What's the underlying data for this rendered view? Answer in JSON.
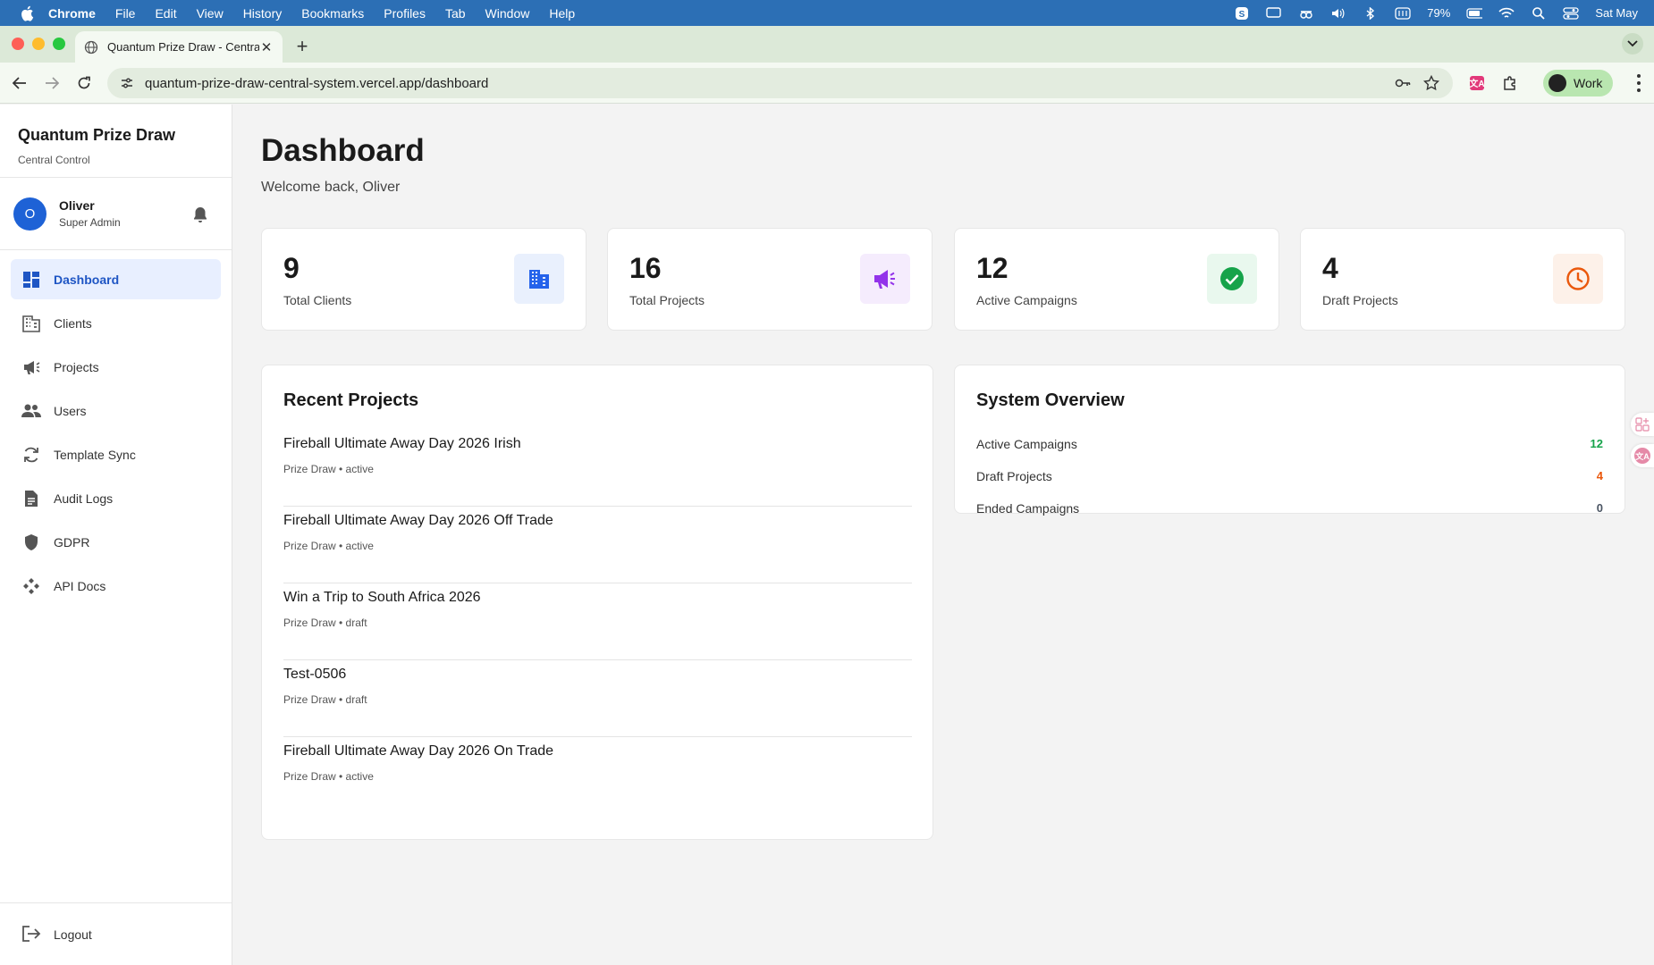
{
  "menubar": {
    "app": "Chrome",
    "items": [
      "File",
      "Edit",
      "View",
      "History",
      "Bookmarks",
      "Profiles",
      "Tab",
      "Window",
      "Help"
    ],
    "battery": "79%",
    "clock": "Sat May"
  },
  "browser": {
    "tab_title": "Quantum Prize Draw - Central",
    "url": "quantum-prize-draw-central-system.vercel.app/dashboard",
    "profile_label": "Work"
  },
  "sidebar": {
    "brand_name": "Quantum Prize Draw",
    "brand_sub": "Central Control",
    "user": {
      "initial": "O",
      "name": "Oliver",
      "role": "Super Admin"
    },
    "items": [
      {
        "label": "Dashboard",
        "icon": "dashboard-icon",
        "active": true
      },
      {
        "label": "Clients",
        "icon": "building-icon"
      },
      {
        "label": "Projects",
        "icon": "megaphone-icon"
      },
      {
        "label": "Users",
        "icon": "users-icon"
      },
      {
        "label": "Template Sync",
        "icon": "sync-icon"
      },
      {
        "label": "Audit Logs",
        "icon": "document-icon"
      },
      {
        "label": "GDPR",
        "icon": "shield-icon"
      },
      {
        "label": "API Docs",
        "icon": "api-icon"
      }
    ],
    "logout_label": "Logout"
  },
  "page": {
    "title": "Dashboard",
    "welcome": "Welcome back, Oliver"
  },
  "stats": [
    {
      "value": "9",
      "label": "Total Clients",
      "icon": "building-icon",
      "color": "#2563eb",
      "bg": "#e9f0fd"
    },
    {
      "value": "16",
      "label": "Total Projects",
      "icon": "megaphone-icon",
      "color": "#9333ea",
      "bg": "#f5ecfd"
    },
    {
      "value": "12",
      "label": "Active Campaigns",
      "icon": "check-circle-icon",
      "color": "#16a34a",
      "bg": "#e9f8ee"
    },
    {
      "value": "4",
      "label": "Draft Projects",
      "icon": "clock-icon",
      "color": "#ea580c",
      "bg": "#fdf1e9"
    }
  ],
  "recent_projects": {
    "title": "Recent Projects",
    "items": [
      {
        "name": "Fireball Ultimate Away Day 2026 Irish",
        "meta": "Prize Draw • active"
      },
      {
        "name": "Fireball Ultimate Away Day 2026 Off Trade",
        "meta": "Prize Draw • active"
      },
      {
        "name": "Win a Trip to South Africa 2026",
        "meta": "Prize Draw • draft"
      },
      {
        "name": "Test-0506",
        "meta": "Prize Draw • draft"
      },
      {
        "name": "Fireball Ultimate Away Day 2026 On Trade",
        "meta": "Prize Draw • active"
      }
    ]
  },
  "system_overview": {
    "title": "System Overview",
    "rows": [
      {
        "label": "Active Campaigns",
        "value": "12",
        "color": "#16a34a"
      },
      {
        "label": "Draft Projects",
        "value": "4",
        "color": "#ea580c"
      },
      {
        "label": "Ended Campaigns",
        "value": "0",
        "color": "#4b5563"
      }
    ]
  }
}
